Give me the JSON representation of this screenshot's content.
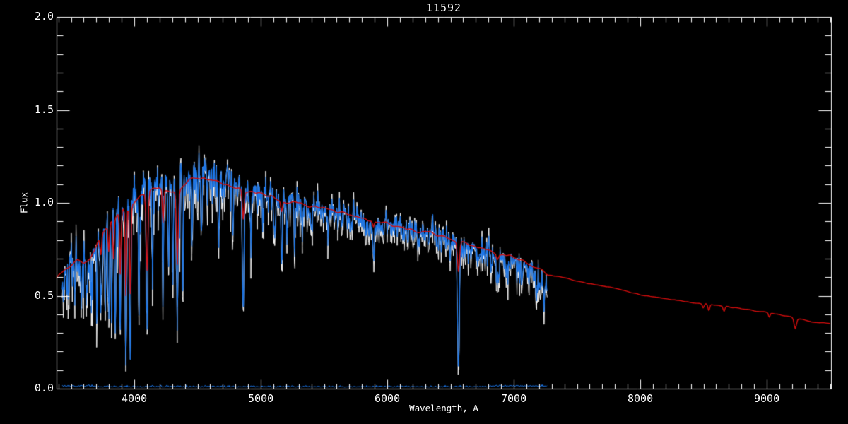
{
  "chart_data": {
    "type": "line",
    "title": "11592",
    "xlabel": "Wavelength, A",
    "ylabel": "Flux",
    "xlim": [
      3385,
      9508
    ],
    "ylim": [
      0.0,
      2.0
    ],
    "grid": false,
    "legend_position": "none",
    "background": "#000000",
    "axes_color": "#ffffff",
    "x_ticks": {
      "major_values": [
        4000,
        5000,
        6000,
        7000,
        8000,
        9000
      ],
      "major_labels": [
        "4000",
        "5000",
        "6000",
        "7000",
        "8000",
        "9000"
      ],
      "minor_step": 100
    },
    "y_ticks": {
      "major_values": [
        0.0,
        0.5,
        1.0,
        1.5,
        2.0
      ],
      "major_labels": [
        "0.0",
        "0.5",
        "1.0",
        "1.5",
        "2.0"
      ],
      "minor_step": 0.1
    },
    "series": [
      {
        "role": "observed_raw",
        "name": "observed spectrum raw (white envelope)",
        "color": "#ffffff",
        "noise_boost": 1.6,
        "line_extra_depth": 0.02
      },
      {
        "role": "observed",
        "name": "observed spectrum",
        "color": "#1c76e8",
        "wavelength_range": [
          3430,
          7268
        ],
        "continuum": [
          [
            3430,
            0.62
          ],
          [
            3480,
            0.68
          ],
          [
            3520,
            0.72
          ],
          [
            3560,
            0.74
          ],
          [
            3600,
            0.7
          ],
          [
            3640,
            0.72
          ],
          [
            3680,
            0.78
          ],
          [
            3720,
            0.85
          ],
          [
            3760,
            0.9
          ],
          [
            3800,
            0.95
          ],
          [
            3850,
            1.02
          ],
          [
            3900,
            1.07
          ],
          [
            3950,
            1.1
          ],
          [
            4000,
            1.13
          ],
          [
            4060,
            1.16
          ],
          [
            4120,
            1.16
          ],
          [
            4180,
            1.17
          ],
          [
            4240,
            1.16
          ],
          [
            4300,
            1.15
          ],
          [
            4360,
            1.17
          ],
          [
            4420,
            1.2
          ],
          [
            4480,
            1.21
          ],
          [
            4540,
            1.21
          ],
          [
            4600,
            1.2
          ],
          [
            4660,
            1.19
          ],
          [
            4720,
            1.17
          ],
          [
            4780,
            1.15
          ],
          [
            4840,
            1.13
          ],
          [
            4900,
            1.11
          ],
          [
            4960,
            1.1
          ],
          [
            5020,
            1.09
          ],
          [
            5080,
            1.08
          ],
          [
            5140,
            1.05
          ],
          [
            5200,
            1.05
          ],
          [
            5260,
            1.04
          ],
          [
            5320,
            1.03
          ],
          [
            5380,
            1.01
          ],
          [
            5440,
            1.0
          ],
          [
            5500,
            0.99
          ],
          [
            5560,
            0.98
          ],
          [
            5620,
            0.97
          ],
          [
            5680,
            0.96
          ],
          [
            5740,
            0.95
          ],
          [
            5800,
            0.93
          ],
          [
            5860,
            0.91
          ],
          [
            5920,
            0.9
          ],
          [
            5980,
            0.92
          ],
          [
            6040,
            0.91
          ],
          [
            6100,
            0.9
          ],
          [
            6160,
            0.88
          ],
          [
            6220,
            0.87
          ],
          [
            6280,
            0.86
          ],
          [
            6340,
            0.85
          ],
          [
            6400,
            0.84
          ],
          [
            6460,
            0.83
          ],
          [
            6520,
            0.82
          ],
          [
            6580,
            0.8
          ],
          [
            6640,
            0.79
          ],
          [
            6700,
            0.78
          ],
          [
            6760,
            0.76
          ],
          [
            6820,
            0.74
          ],
          [
            6880,
            0.72
          ],
          [
            6940,
            0.73
          ],
          [
            7000,
            0.71
          ],
          [
            7060,
            0.69
          ],
          [
            7120,
            0.67
          ],
          [
            7180,
            0.65
          ],
          [
            7240,
            0.62
          ],
          [
            7268,
            0.58
          ]
        ],
        "absorption_lines": [
          [
            3530,
            0.55,
            4
          ],
          [
            3580,
            0.5,
            4
          ],
          [
            3620,
            0.54,
            4
          ],
          [
            3660,
            0.52,
            4
          ],
          [
            3705,
            0.5,
            4
          ],
          [
            3735,
            0.45,
            5
          ],
          [
            3770,
            0.48,
            4
          ],
          [
            3798,
            0.43,
            4
          ],
          [
            3820,
            0.47,
            4
          ],
          [
            3849,
            0.33,
            5
          ],
          [
            3889,
            0.33,
            5
          ],
          [
            3933,
            0.15,
            5
          ],
          [
            3968,
            0.13,
            5
          ],
          [
            4037,
            0.47,
            4
          ],
          [
            4101,
            0.34,
            6
          ],
          [
            4144,
            0.68,
            4
          ],
          [
            4227,
            0.52,
            4
          ],
          [
            4271,
            0.7,
            4
          ],
          [
            4305,
            0.66,
            5
          ],
          [
            4340,
            0.4,
            6
          ],
          [
            4383,
            0.58,
            4
          ],
          [
            4455,
            0.82,
            4
          ],
          [
            4531,
            0.8,
            4
          ],
          [
            4668,
            0.84,
            4
          ],
          [
            4780,
            0.85,
            4
          ],
          [
            4861,
            0.44,
            6
          ],
          [
            4920,
            0.87,
            4
          ],
          [
            5015,
            0.89,
            4
          ],
          [
            5110,
            0.85,
            4
          ],
          [
            5165,
            0.7,
            5
          ],
          [
            5208,
            0.82,
            4
          ],
          [
            5270,
            0.8,
            5
          ],
          [
            5328,
            0.87,
            4
          ],
          [
            5400,
            0.88,
            4
          ],
          [
            5530,
            0.87,
            4
          ],
          [
            5710,
            0.86,
            4
          ],
          [
            5890,
            0.73,
            6
          ],
          [
            6122,
            0.8,
            4
          ],
          [
            6162,
            0.82,
            4
          ],
          [
            6250,
            0.79,
            4
          ],
          [
            6360,
            0.97,
            2
          ],
          [
            6495,
            0.75,
            4
          ],
          [
            6563,
            0.11,
            7
          ],
          [
            6717,
            0.7,
            4
          ],
          [
            6870,
            0.6,
            8
          ],
          [
            6940,
            0.66,
            5
          ],
          [
            7060,
            0.6,
            5
          ],
          [
            7180,
            0.54,
            6
          ],
          [
            7240,
            0.5,
            5
          ]
        ],
        "noise": {
          "seed": 7,
          "sym_amp": [
            [
              3430,
              0.05
            ],
            [
              4000,
              0.045
            ],
            [
              5000,
              0.035
            ],
            [
              6000,
              0.025
            ],
            [
              7268,
              0.03
            ]
          ],
          "down_amp": [
            [
              3430,
              0.12
            ],
            [
              3700,
              0.12
            ],
            [
              3900,
              0.1
            ],
            [
              4100,
              0.09
            ],
            [
              4400,
              0.08
            ],
            [
              4700,
              0.065
            ],
            [
              5000,
              0.055
            ],
            [
              5500,
              0.05
            ],
            [
              6000,
              0.045
            ],
            [
              6500,
              0.04
            ],
            [
              6800,
              0.06
            ],
            [
              7100,
              0.07
            ],
            [
              7268,
              0.09
            ]
          ]
        }
      },
      {
        "role": "model",
        "name": "model fit spectrum",
        "color": "#d40d0d",
        "wavelength_range": [
          3385,
          9508
        ],
        "points": [
          [
            3385,
            0.6
          ],
          [
            3450,
            0.645
          ],
          [
            3500,
            0.665
          ],
          [
            3550,
            0.7
          ],
          [
            3600,
            0.675
          ],
          [
            3650,
            0.7
          ],
          [
            3700,
            0.775
          ],
          [
            3750,
            0.84
          ],
          [
            3800,
            0.885
          ],
          [
            3850,
            0.925
          ],
          [
            3900,
            0.96
          ],
          [
            3950,
            0.975
          ],
          [
            4000,
            1.01
          ],
          [
            4050,
            1.045
          ],
          [
            4100,
            1.05
          ],
          [
            4150,
            1.075
          ],
          [
            4200,
            1.08
          ],
          [
            4250,
            1.065
          ],
          [
            4300,
            1.055
          ],
          [
            4350,
            1.06
          ],
          [
            4400,
            1.1
          ],
          [
            4450,
            1.125
          ],
          [
            4500,
            1.135
          ],
          [
            4550,
            1.13
          ],
          [
            4600,
            1.12
          ],
          [
            4700,
            1.1
          ],
          [
            4800,
            1.075
          ],
          [
            4900,
            1.06
          ],
          [
            5000,
            1.05
          ],
          [
            5100,
            1.03
          ],
          [
            5200,
            1.005
          ],
          [
            5300,
            1.0
          ],
          [
            5400,
            0.985
          ],
          [
            5500,
            0.97
          ],
          [
            5600,
            0.95
          ],
          [
            5700,
            0.935
          ],
          [
            5800,
            0.915
          ],
          [
            5900,
            0.9
          ],
          [
            6000,
            0.89
          ],
          [
            6100,
            0.875
          ],
          [
            6200,
            0.855
          ],
          [
            6300,
            0.84
          ],
          [
            6400,
            0.825
          ],
          [
            6500,
            0.805
          ],
          [
            6600,
            0.785
          ],
          [
            6700,
            0.765
          ],
          [
            6800,
            0.745
          ],
          [
            6900,
            0.725
          ],
          [
            7000,
            0.705
          ],
          [
            7100,
            0.675
          ],
          [
            7200,
            0.65
          ],
          [
            7270,
            0.615
          ],
          [
            7400,
            0.595
          ],
          [
            7600,
            0.565
          ],
          [
            7800,
            0.54
          ],
          [
            8000,
            0.505
          ],
          [
            8200,
            0.485
          ],
          [
            8400,
            0.465
          ],
          [
            8600,
            0.45
          ],
          [
            8800,
            0.43
          ],
          [
            9000,
            0.41
          ],
          [
            9200,
            0.385
          ],
          [
            9350,
            0.36
          ],
          [
            9508,
            0.35
          ]
        ],
        "line_dips": [
          [
            3735,
            0.72,
            6
          ],
          [
            3798,
            0.74,
            5
          ],
          [
            3835,
            0.7,
            5
          ],
          [
            3889,
            0.62,
            5
          ],
          [
            3933,
            0.5,
            5
          ],
          [
            3968,
            0.52,
            5
          ],
          [
            4101,
            0.63,
            7
          ],
          [
            4227,
            0.9,
            5
          ],
          [
            4340,
            0.67,
            7
          ],
          [
            4861,
            0.92,
            7
          ],
          [
            5165,
            0.96,
            6
          ],
          [
            5890,
            0.87,
            6
          ],
          [
            6563,
            0.63,
            8
          ],
          [
            6870,
            0.7,
            8
          ],
          [
            8498,
            0.435,
            7
          ],
          [
            8542,
            0.42,
            7
          ],
          [
            8662,
            0.415,
            7
          ],
          [
            9020,
            0.385,
            6
          ],
          [
            9225,
            0.325,
            9
          ]
        ],
        "wiggle_amp_blue": 0.035,
        "wiggle_amp_red": 0.009
      },
      {
        "role": "error",
        "name": "error spectrum",
        "color": "#1c76e8",
        "wavelength_range": [
          3430,
          7268
        ],
        "base_level": 0.008,
        "noise_amp": 0.004
      }
    ]
  }
}
